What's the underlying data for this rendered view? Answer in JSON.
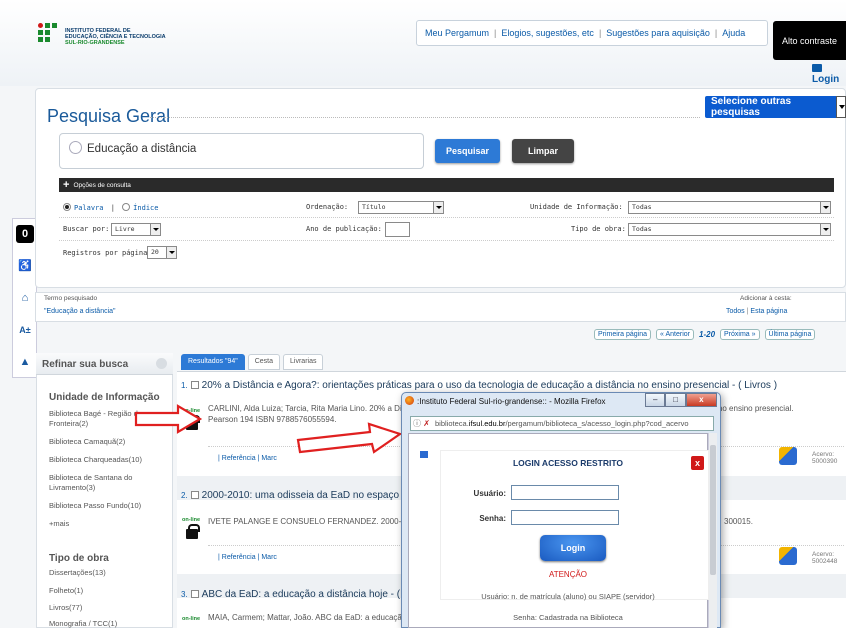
{
  "header": {
    "logo_lines": [
      "INSTITUTO FEDERAL DE",
      "EDUCAÇÃO, CIÊNCIA E TECNOLOGIA",
      "SUL-RIO-GRANDENSE"
    ],
    "top_links": [
      "Meu Pergamum",
      "Elogios, sugestões, etc",
      "Sugestões para aquisição",
      "Ajuda"
    ],
    "contrast": "Alto contraste",
    "login": "Login"
  },
  "a11y": {
    "contrast_icon": "0",
    "font_icon": "A±"
  },
  "search": {
    "title": "Pesquisa Geral",
    "other_searches": "Selecione outras pesquisas",
    "query": "Educação a distância",
    "search_btn": "Pesquisar",
    "clear_btn": "Limpar",
    "options_label": "Opções de consulta",
    "radio_word": "Palavra",
    "radio_index": "Índice",
    "ordering_label": "Ordenação:",
    "ordering_value": "Título",
    "unit_label": "Unidade de Informação:",
    "unit_value": "Todas",
    "search_by_label": "Buscar por:",
    "search_by_value": "Livre",
    "year_label": "Ano de publicação:",
    "type_label": "Tipo de obra:",
    "type_value": "Todas",
    "per_page_label": "Registros por página:",
    "per_page_value": "20"
  },
  "term": {
    "label": "Termo pesquisado",
    "value": "\"Educação a distância\"",
    "cesta_label": "Adicionar à cesta:",
    "cesta_all": "Todos",
    "cesta_page": "Esta página"
  },
  "pager": {
    "first": "Primeira página",
    "prev": "« Anterior",
    "range": "1-20",
    "next": "Próxima »",
    "last": "Última página"
  },
  "refine": {
    "title": "Refinar sua busca",
    "unit_title": "Unidade de Informação",
    "units": [
      "Biblioteca Bagé - Região de Fronteira(2)",
      "Biblioteca Camaquã(2)",
      "Biblioteca Charqueadas(10)",
      "Biblioteca de Santana do Livramento(3)",
      "Biblioteca Passo Fundo(10)",
      "+mais"
    ],
    "type_title": "Tipo de obra",
    "types": [
      "Dissertações(13)",
      "Folheto(1)",
      "Livros(77)",
      "Monografia / TCC(1)"
    ]
  },
  "tabs": [
    "Resultados \"94\"",
    "Cesta",
    "Livrarias"
  ],
  "results": [
    {
      "num": "1.",
      "title": "20% a Distância e Agora?: orientações práticas para o uso da tecnologia de educação a distância no ensino presencial - ( Livros )",
      "body1": "CARLINI, Alda Luiza; Tarcia, Rita Maria Lino. 20% a Distância e Agora?: orientações práticas para o uso da tecnologia de educação a distância no ensino presencial.",
      "body2": "Pearson 194 ISBN 9788576055594.",
      "acervo_label": "Acervo:",
      "acervo": "5000390"
    },
    {
      "num": "2.",
      "title": "2000-2010: uma odisseia da EaD no espaço",
      "body1": "IVETE PALANGE E CONSUELO FERNANDEZ. 2000-2010: uma odisseia da EaD no espaço",
      "body2": "300015.",
      "acervo_label": "Acervo:",
      "acervo": "5002448"
    },
    {
      "num": "3.",
      "title": "ABC da EaD: a educação a distância hoje - (",
      "body1": "MAIA, Carmem; Mattar, João. ABC da EaD: a educação",
      "body2": "",
      "acervo_label": "",
      "acervo": ""
    }
  ],
  "result_links": {
    "ref": "Referência",
    "marc": "Marc",
    "online": "on-line"
  },
  "popup": {
    "window_title": ":Instituto Federal Sul-rio-grandense:: - Mozilla Firefox",
    "url_prefix": "biblioteca.",
    "url_domain": "ifsul.edu.br",
    "url_rest": "/pergamum/biblioteca_s/acesso_login.php?cod_acervo",
    "box_title": "LOGIN ACESSO RESTRITO",
    "close": "x",
    "user_label": "Usuário:",
    "pass_label": "Senha:",
    "login_btn": "Login",
    "attention": "ATENÇÃO",
    "info_user": "Usuário: n. de matrícula (aluno) ou SIAPE (servidor)",
    "info_pass": "Senha: Cadastrada na Biblioteca"
  },
  "colors": {
    "accent": "#2d7ad6",
    "arrow": "#e02020",
    "brand_green": "#1a8a2e"
  }
}
